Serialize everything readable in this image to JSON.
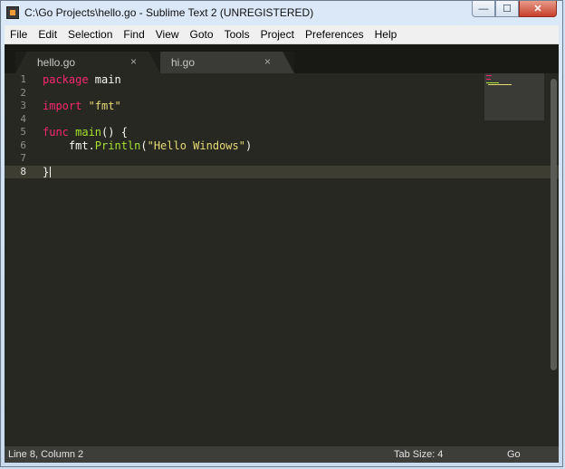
{
  "window": {
    "title": "C:\\Go Projects\\hello.go - Sublime Text 2 (UNREGISTERED)",
    "buttons": {
      "minimize": "—",
      "maximize": "☐",
      "close": "✕"
    }
  },
  "menu": [
    "File",
    "Edit",
    "Selection",
    "Find",
    "View",
    "Goto",
    "Tools",
    "Project",
    "Preferences",
    "Help"
  ],
  "tabs": [
    {
      "label": "hello.go",
      "close": "×"
    },
    {
      "label": "hi.go",
      "close": "×"
    }
  ],
  "editor": {
    "line_numbers": [
      "1",
      "2",
      "3",
      "4",
      "5",
      "6",
      "7",
      "8"
    ],
    "current_line": "8",
    "lines": {
      "l1_kw": "package",
      "l1_rest": " main",
      "l3_kw": "import",
      "l3_str": " \"fmt\"",
      "l5_kw": "func",
      "l5_fn": " main",
      "l5_rest": "() {",
      "l6_obj": "    fmt.",
      "l6_fn": "Println",
      "l6_open": "(",
      "l6_str": "\"Hello Windows\"",
      "l6_close": ")",
      "l8": "}"
    }
  },
  "status": {
    "position": "Line 8, Column 2",
    "tab_size": "Tab Size: 4",
    "syntax": "Go"
  },
  "colors": {
    "editor_bg": "#272822",
    "keyword": "#f92672",
    "function": "#a6e22e",
    "string": "#e6db74",
    "text": "#f8f8f2"
  },
  "icons": [
    "sublime-app-icon",
    "minimize-icon",
    "maximize-icon",
    "close-icon",
    "tab-close-icon"
  ]
}
